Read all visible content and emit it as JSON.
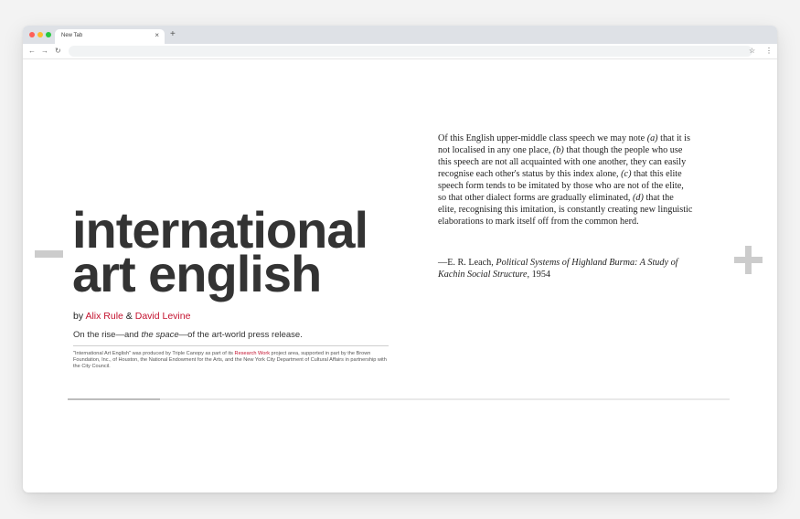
{
  "browser": {
    "tab_title": "New Tab",
    "tab_close": "×",
    "new_tab": "+",
    "back": "←",
    "forward": "→",
    "reload": "↻",
    "bookmark": "☆",
    "menu": "⋮"
  },
  "article": {
    "title_line1": "international",
    "title_line2": "art english",
    "byline_prefix": "by",
    "author1": "Alix Rule",
    "byline_and": "&",
    "author2": "David Levine",
    "subtitle_pre": "On the rise—and ",
    "subtitle_em": "the space",
    "subtitle_post": "—of the art-world press release.",
    "credit_pre": "\"International Art English\" was produced by Triple Canopy as part of its ",
    "credit_link": "Research Work",
    "credit_post": " project area, supported in part by the Brown Foundation, Inc., of Houston, the National Endowment for the Arts, and the New York City Department of Cultural Affairs in partnership with the City Council."
  },
  "quote": {
    "t1": "Of this English upper-middle class speech we may note ",
    "m1": "(a)",
    "t2": " that it is not localised in any one place, ",
    "m2": "(b)",
    "t3": " that though the people who use this speech are not all acquainted with one another, they can easily recognise each other's status by this index alone, ",
    "m3": "(c)",
    "t4": " that this elite speech form tends to be imitated by those who are not of the elite, so that other dialect forms are gradually eliminated, ",
    "m4": "(d)",
    "t5": " that the elite, recognising this imitation, is constantly creating new linguistic elaborations to mark itself off from the common herd.",
    "attr_pre": "—E. R. Leach, ",
    "attr_title": "Political Systems of Highland Burma: A Study of Kachin Social Structure",
    "attr_year": ", 1954"
  },
  "reading_progress": 0.14,
  "colors": {
    "accent": "#c4122f",
    "title": "#333333",
    "ornament": "#cccccc"
  }
}
